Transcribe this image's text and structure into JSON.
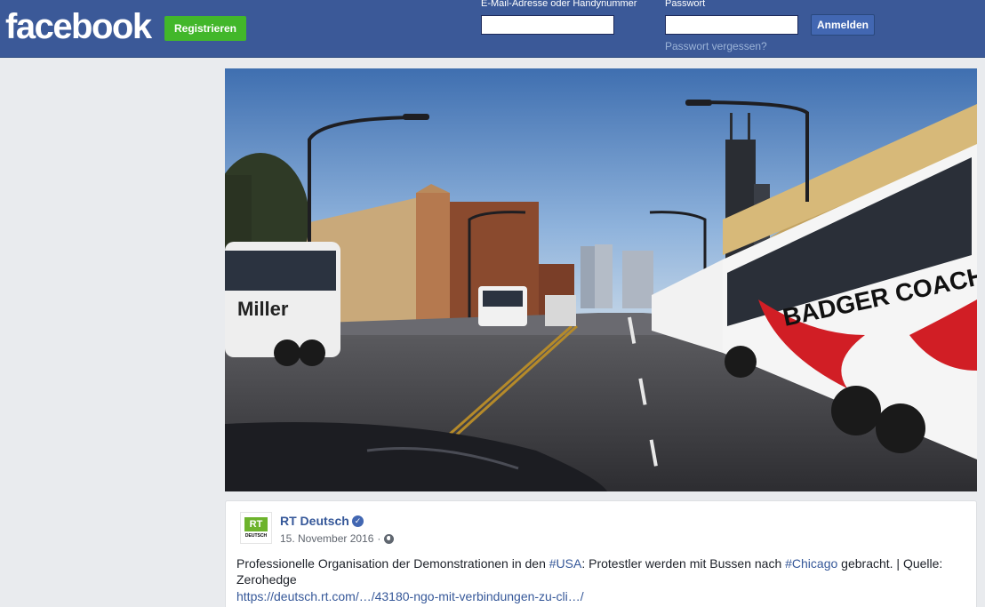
{
  "header": {
    "logo": "facebook",
    "register_label": "Registrieren",
    "email_label": "E-Mail-Adresse oder Handynummer",
    "password_label": "Passwort",
    "email_value": "",
    "password_value": "",
    "login_label": "Anmelden",
    "forgot_label": "Passwort vergessen?"
  },
  "video": {
    "left_bus_text": "Miller",
    "right_bus_text": "BADGER COACHES"
  },
  "post": {
    "avatar_text": "RT",
    "avatar_subtext": "DEUTSCH",
    "page_name": "RT Deutsch",
    "date": "15. November 2016",
    "separator": "·",
    "text_part1": "Professionelle Organisation der Demonstrationen in den ",
    "hashtag1": "#USA",
    "text_part2": ": Protestler werden mit Bussen nach ",
    "hashtag2": "#Chicago",
    "text_part3": " gebracht. | Quelle: Zerohedge",
    "link": "https://deutsch.rt.com/…/43180-ngo-mit-verbindungen-zu-cli…/"
  },
  "colors": {
    "brand_blue": "#3b5998",
    "register_green": "#42b72a",
    "link_blue": "#365899"
  }
}
